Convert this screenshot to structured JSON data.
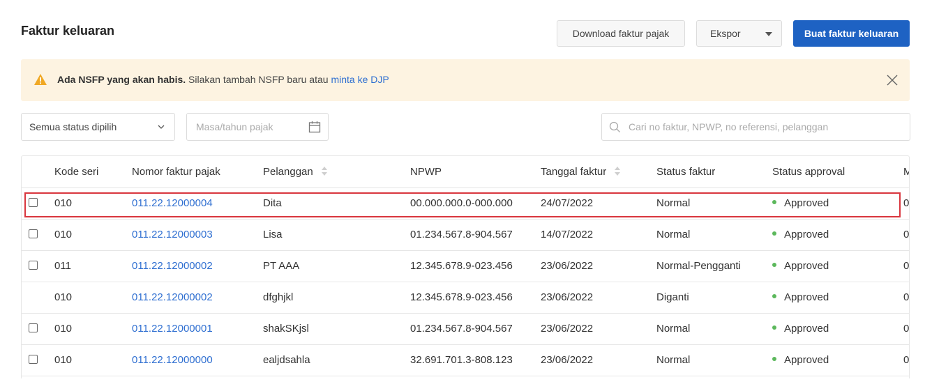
{
  "page": {
    "title": "Faktur keluaran"
  },
  "toolbar": {
    "download_label": "Download faktur pajak",
    "ekspor_label": "Ekspor",
    "create_label": "Buat faktur keluaran"
  },
  "alert": {
    "bold": "Ada NSFP yang akan habis.",
    "text": " Silakan tambah NSFP baru atau ",
    "link": "minta ke DJP"
  },
  "filters": {
    "status_value": "Semua status dipilih",
    "date_placeholder": "Masa/tahun pajak",
    "search_placeholder": "Cari no faktur, NPWP, no referensi, pelanggan"
  },
  "table": {
    "columns": [
      "Kode seri",
      "Nomor faktur pajak",
      "Pelanggan",
      "NPWP",
      "Tanggal faktur",
      "Status faktur",
      "Status approval",
      "M"
    ],
    "rows": [
      {
        "kode": "010",
        "nomor": "011.22.12000004",
        "pelanggan": "Dita",
        "npwp": "00.000.000.0-000.000",
        "tanggal": "24/07/2022",
        "status": "Normal",
        "approval": "Approved",
        "extra": "0"
      },
      {
        "kode": "010",
        "nomor": "011.22.12000003",
        "pelanggan": "Lisa",
        "npwp": "01.234.567.8-904.567",
        "tanggal": "14/07/2022",
        "status": "Normal",
        "approval": "Approved",
        "extra": "0"
      },
      {
        "kode": "011",
        "nomor": "011.22.12000002",
        "pelanggan": "PT AAA",
        "npwp": "12.345.678.9-023.456",
        "tanggal": "23/06/2022",
        "status": "Normal-Pengganti",
        "approval": "Approved",
        "extra": "0"
      },
      {
        "kode": "010",
        "nomor": "011.22.12000002",
        "pelanggan": "dfghjkl",
        "npwp": "12.345.678.9-023.456",
        "tanggal": "23/06/2022",
        "status": "Diganti",
        "approval": "Approved",
        "extra": "0"
      },
      {
        "kode": "010",
        "nomor": "011.22.12000001",
        "pelanggan": "shakSKjsl",
        "npwp": "01.234.567.8-904.567",
        "tanggal": "23/06/2022",
        "status": "Normal",
        "approval": "Approved",
        "extra": "0"
      },
      {
        "kode": "010",
        "nomor": "011.22.12000000",
        "pelanggan": "ealjdsahla",
        "npwp": "32.691.701.3-808.123",
        "tanggal": "23/06/2022",
        "status": "Normal",
        "approval": "Approved",
        "extra": "0"
      }
    ]
  },
  "colors": {
    "primary": "#1e62c3",
    "link": "#2f6fd1",
    "alert_bg": "#fdf3e1",
    "approved_dot": "#5cb85c",
    "highlight": "#d9363e"
  },
  "icons": {
    "warning": "warning-icon",
    "close": "close-icon",
    "calendar": "calendar-icon",
    "search": "search-icon"
  }
}
